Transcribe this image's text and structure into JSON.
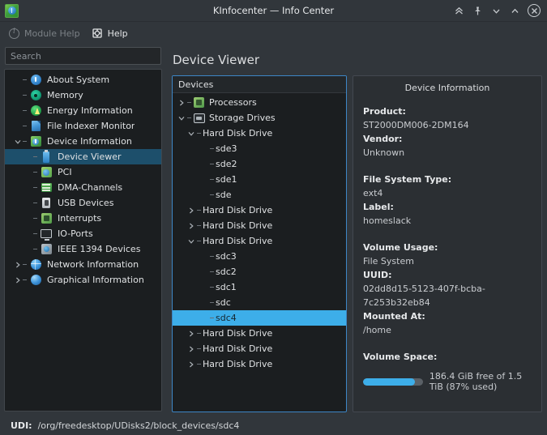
{
  "window": {
    "title": "KInfocenter — Info Center",
    "app_icon": "kinfocenter-icon",
    "buttons": [
      {
        "name": "keep-above-button",
        "icon": "double-chevron-up-icon"
      },
      {
        "name": "pin-button",
        "icon": "pin-icon"
      },
      {
        "name": "minimize-button",
        "icon": "chevron-down-icon"
      },
      {
        "name": "maximize-button",
        "icon": "chevron-up-icon"
      },
      {
        "name": "close-button",
        "icon": "close-icon"
      }
    ]
  },
  "toolbar": {
    "module_help_label": "Module Help",
    "module_help_enabled": false,
    "help_label": "Help"
  },
  "search": {
    "placeholder": "Search",
    "value": ""
  },
  "sidebar": {
    "items": [
      {
        "label": "About System",
        "icon": "info-icon",
        "level": 1,
        "arrow": "none",
        "selected": false
      },
      {
        "label": "Memory",
        "icon": "memory-icon",
        "level": 1,
        "arrow": "none",
        "selected": false
      },
      {
        "label": "Energy Information",
        "icon": "energy-icon",
        "level": 1,
        "arrow": "none",
        "selected": false
      },
      {
        "label": "File Indexer Monitor",
        "icon": "file-icon",
        "level": 1,
        "arrow": "none",
        "selected": false
      },
      {
        "label": "Device Information",
        "icon": "device-info-icon",
        "level": 1,
        "arrow": "expanded",
        "selected": false
      },
      {
        "label": "Device Viewer",
        "icon": "usb-stick-icon",
        "level": 2,
        "arrow": "none",
        "selected": true
      },
      {
        "label": "PCI",
        "icon": "pci-icon",
        "level": 2,
        "arrow": "none",
        "selected": false
      },
      {
        "label": "DMA-Channels",
        "icon": "dma-icon",
        "level": 2,
        "arrow": "none",
        "selected": false
      },
      {
        "label": "USB Devices",
        "icon": "usb-device-icon",
        "level": 2,
        "arrow": "none",
        "selected": false
      },
      {
        "label": "Interrupts",
        "icon": "interrupt-icon",
        "level": 2,
        "arrow": "none",
        "selected": false
      },
      {
        "label": "IO-Ports",
        "icon": "monitor-icon",
        "level": 2,
        "arrow": "none",
        "selected": false
      },
      {
        "label": "IEEE 1394 Devices",
        "icon": "firewire-icon",
        "level": 2,
        "arrow": "none",
        "selected": false
      },
      {
        "label": "Network Information",
        "icon": "globe-icon",
        "level": 1,
        "arrow": "collapsed",
        "selected": false
      },
      {
        "label": "Graphical Information",
        "icon": "sphere-icon",
        "level": 1,
        "arrow": "collapsed",
        "selected": false
      }
    ]
  },
  "main": {
    "page_title": "Device Viewer"
  },
  "device_tree": {
    "header": "Devices",
    "rows": [
      {
        "label": "Processors",
        "level": 0,
        "arrow": "collapsed",
        "icon": "cpu-icon",
        "selected": false
      },
      {
        "label": "Storage Drives",
        "level": 0,
        "arrow": "expanded",
        "icon": "drive-icon",
        "selected": false
      },
      {
        "label": "Hard Disk Drive",
        "level": 1,
        "arrow": "expanded",
        "icon": "none",
        "selected": false
      },
      {
        "label": "sde3",
        "level": 2,
        "arrow": "none",
        "icon": "none",
        "selected": false
      },
      {
        "label": "sde2",
        "level": 2,
        "arrow": "none",
        "icon": "none",
        "selected": false
      },
      {
        "label": "sde1",
        "level": 2,
        "arrow": "none",
        "icon": "none",
        "selected": false
      },
      {
        "label": "sde",
        "level": 2,
        "arrow": "none",
        "icon": "none",
        "selected": false
      },
      {
        "label": "Hard Disk Drive",
        "level": 1,
        "arrow": "collapsed",
        "icon": "none",
        "selected": false
      },
      {
        "label": "Hard Disk Drive",
        "level": 1,
        "arrow": "collapsed",
        "icon": "none",
        "selected": false
      },
      {
        "label": "Hard Disk Drive",
        "level": 1,
        "arrow": "expanded",
        "icon": "none",
        "selected": false
      },
      {
        "label": "sdc3",
        "level": 2,
        "arrow": "none",
        "icon": "none",
        "selected": false
      },
      {
        "label": "sdc2",
        "level": 2,
        "arrow": "none",
        "icon": "none",
        "selected": false
      },
      {
        "label": "sdc1",
        "level": 2,
        "arrow": "none",
        "icon": "none",
        "selected": false
      },
      {
        "label": "sdc",
        "level": 2,
        "arrow": "none",
        "icon": "none",
        "selected": false
      },
      {
        "label": "sdc4",
        "level": 2,
        "arrow": "none",
        "icon": "none",
        "selected": true
      },
      {
        "label": "Hard Disk Drive",
        "level": 1,
        "arrow": "collapsed",
        "icon": "none",
        "selected": false
      },
      {
        "label": "Hard Disk Drive",
        "level": 1,
        "arrow": "collapsed",
        "icon": "none",
        "selected": false
      },
      {
        "label": "Hard Disk Drive",
        "level": 1,
        "arrow": "collapsed",
        "icon": "none",
        "selected": false
      }
    ]
  },
  "device_info": {
    "title": "Device Information",
    "fields": [
      {
        "key": "Product:",
        "value": "ST2000DM006-2DM164"
      },
      {
        "key": "Vendor:",
        "value": "Unknown"
      },
      {
        "key": "File System Type:",
        "value": "ext4"
      },
      {
        "key": "Label:",
        "value": "homeslack"
      },
      {
        "key": "Volume Usage:",
        "value": "File System"
      },
      {
        "key": "UUID:",
        "value": "02dd8d15-5123-407f-bcba-7c253b32eb84"
      },
      {
        "key": "Mounted At:",
        "value": "/home"
      }
    ],
    "volume_space_key": "Volume Space:",
    "volume_space_text": "186.4 GiB free of 1.5 TiB (87% used)",
    "volume_used_percent": 87
  },
  "statusbar": {
    "key": "UDI:",
    "value": "/org/freedesktop/UDisks2/block_devices/sdc4"
  },
  "colors": {
    "accent": "#3daee9",
    "window_bg": "#31363b",
    "view_bg": "#1b1e20",
    "panel_bg": "#2b2f33",
    "sidebar_selection": "#1d4f6b"
  }
}
